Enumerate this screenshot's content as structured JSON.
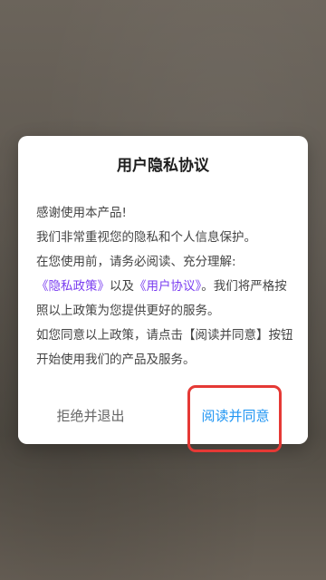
{
  "dialog": {
    "title": "用户隐私协议",
    "body": {
      "line1": "感谢使用本产品!",
      "line2": "我们非常重视您的隐私和个人信息保护。",
      "line3": "在您使用前，请务必阅读、充分理解:",
      "privacy_link": "《隐私政策》",
      "connector": "以及",
      "user_link": "《用户协议》",
      "line4_tail": "。我们将严格按照以上政策为您提供更好的服务。",
      "line5": "如您同意以上政策，请点击【阅读并同意】按钮开始使用我们的产品及服务。"
    },
    "decline_label": "拒绝并退出",
    "agree_label": "阅读并同意"
  },
  "colors": {
    "link": "#7a3df0",
    "agree": "#2196f3",
    "highlight": "#e53935"
  }
}
